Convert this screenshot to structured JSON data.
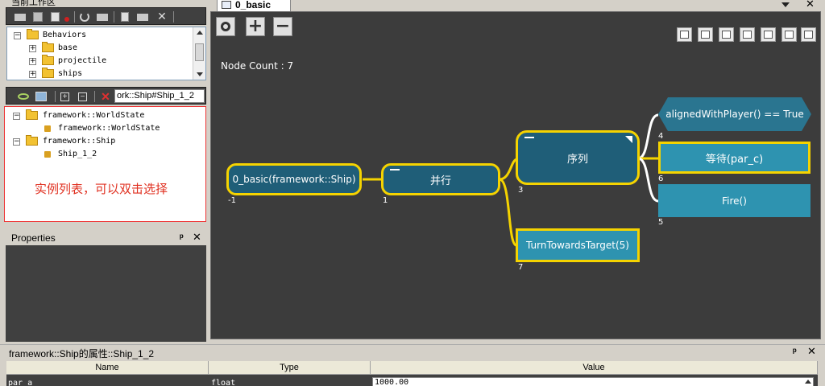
{
  "workspace": {
    "title": "当前工作区",
    "tree": [
      {
        "label": "Behaviors",
        "expanded": true
      },
      {
        "label": "base",
        "expanded": false
      },
      {
        "label": "projectile",
        "expanded": false
      },
      {
        "label": "ships",
        "expanded": false
      }
    ]
  },
  "instances": {
    "path_text": "ork::Ship#Ship_1_2",
    "tree": [
      {
        "label": "framework::WorldState"
      },
      {
        "label": "framework::WorldState"
      },
      {
        "label": "framework::Ship"
      },
      {
        "label": "Ship_1_2"
      }
    ],
    "hint": "实例列表，可以双击选择"
  },
  "properties": {
    "title": "Properties",
    "pin": "ᵖ",
    "close": "✕"
  },
  "editor": {
    "tab_label": "0_basic",
    "node_count_label": "Node Count : 7",
    "nodes": {
      "root": {
        "label": "0_basic(framework::Ship)",
        "id": "-1"
      },
      "parallel": {
        "label": "并行",
        "id": "1"
      },
      "sequence": {
        "label": "序列",
        "id": "3"
      },
      "condition": {
        "label": "alignedWithPlayer() == True",
        "id": "4"
      },
      "wait": {
        "label": "等待(par_c)",
        "id": "6"
      },
      "fire": {
        "label": "Fire()",
        "id": "5"
      },
      "turn": {
        "label": "TurnTowardsTarget(5)",
        "id": "7"
      }
    },
    "colors": {
      "canvas": "#3c3c3c",
      "node": "#1f5e78",
      "leaf": "#2e93b0",
      "highlight": "#f5d300",
      "condition": "#2a7590"
    }
  },
  "bottom_panel": {
    "title": "framework::Ship的属性::Ship_1_2",
    "columns": [
      "Name",
      "Type",
      "Value"
    ],
    "row": {
      "name": "par_a",
      "type": "float",
      "value": "1000.00"
    }
  }
}
